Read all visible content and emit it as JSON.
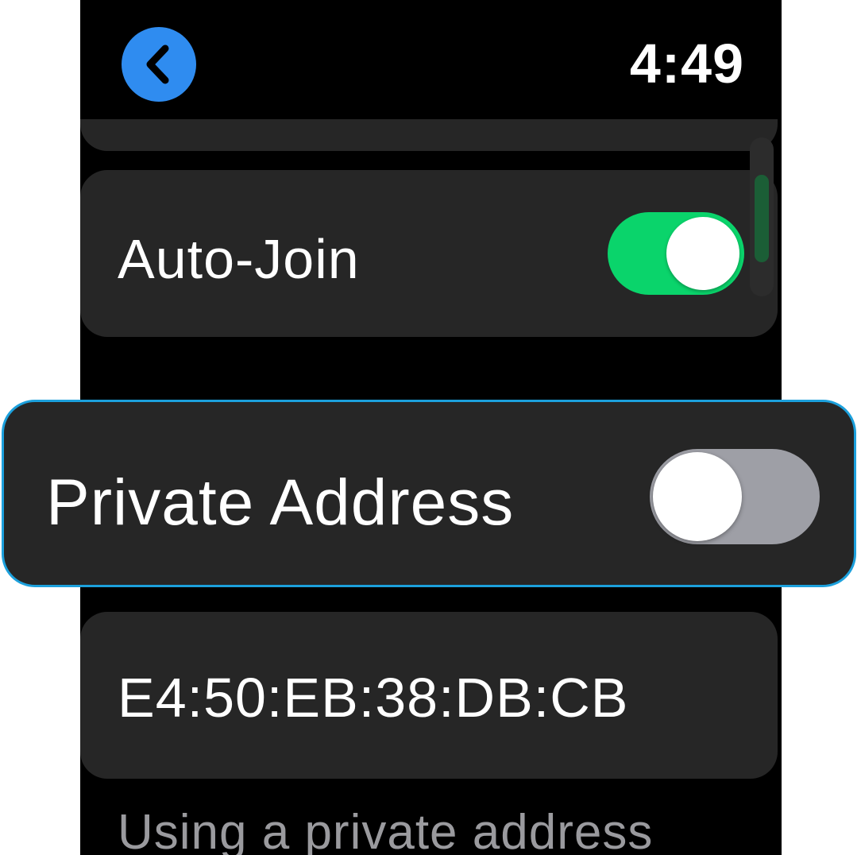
{
  "status_bar": {
    "back_icon": "chevron-left-icon",
    "time": "4:49"
  },
  "settings": {
    "auto_join": {
      "label": "Auto-Join",
      "enabled": true,
      "toggle_color": "#0ad46b"
    },
    "private_address": {
      "label": "Private Address",
      "enabled": false,
      "toggle_color": "#9e9fa6",
      "highlight_color": "#1ca0dc"
    },
    "mac_address": {
      "value": "E4:50:EB:38:DB:CB"
    },
    "footer": {
      "text": "Using a private address"
    }
  },
  "colors": {
    "accent_blue": "#2f8cf0",
    "cell_background": "#262626",
    "screen_background": "#000000",
    "secondary_text": "#9a9a9e"
  }
}
